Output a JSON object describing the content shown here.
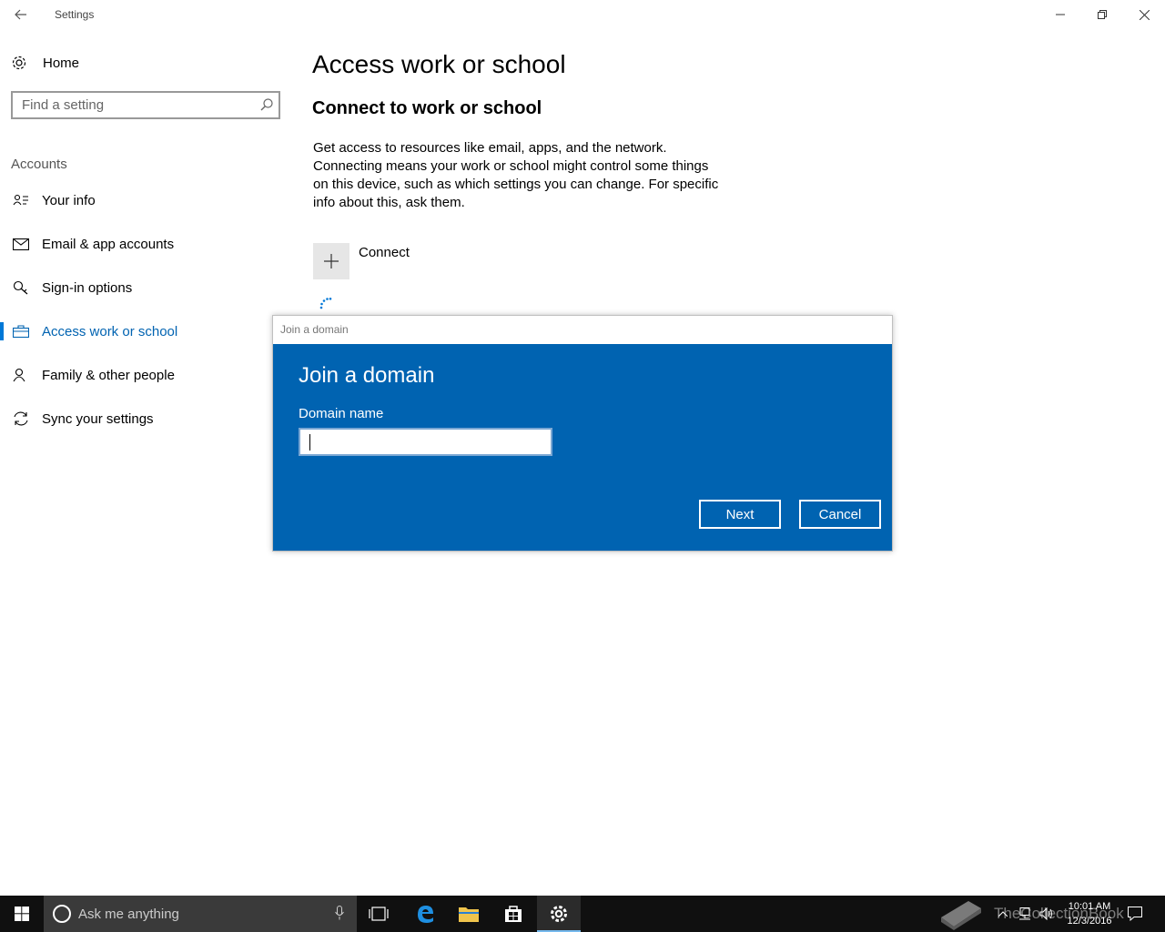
{
  "window": {
    "title": "Settings",
    "back_icon": "back-arrow-icon",
    "controls": [
      "minimize-icon",
      "restore-icon",
      "close-icon"
    ]
  },
  "sidebar": {
    "home_label": "Home",
    "home_icon": "gear-icon",
    "search_placeholder": "Find a setting",
    "section_label": "Accounts",
    "items": [
      {
        "label": "Your info",
        "icon": "person-card-icon",
        "active": false
      },
      {
        "label": "Email & app accounts",
        "icon": "mail-icon",
        "active": false
      },
      {
        "label": "Sign-in options",
        "icon": "key-icon",
        "active": false
      },
      {
        "label": "Access work or school",
        "icon": "briefcase-icon",
        "active": true
      },
      {
        "label": "Family & other people",
        "icon": "person-add-icon",
        "active": false
      },
      {
        "label": "Sync your settings",
        "icon": "sync-icon",
        "active": false
      }
    ]
  },
  "main": {
    "title": "Access work or school",
    "subtitle": "Connect to work or school",
    "description": "Get access to resources like email, apps, and the network. Connecting means your work or school might control some things on this device, such as which settings you can change. For specific info about this, ask them.",
    "connect_label": "Connect"
  },
  "dialog": {
    "window_title": "Join a domain",
    "heading": "Join a domain",
    "field_label": "Domain name",
    "field_value": "",
    "next_label": "Next",
    "cancel_label": "Cancel"
  },
  "taskbar": {
    "search_placeholder": "Ask me anything",
    "time": "10:01 AM",
    "date": "12/3/2016",
    "watermark": "TheCollectionBook",
    "accent": "#0078d7"
  },
  "colors": {
    "dialog_bg": "#0063b1",
    "active_nav": "#0063b1",
    "taskbar_bg": "#101010"
  }
}
